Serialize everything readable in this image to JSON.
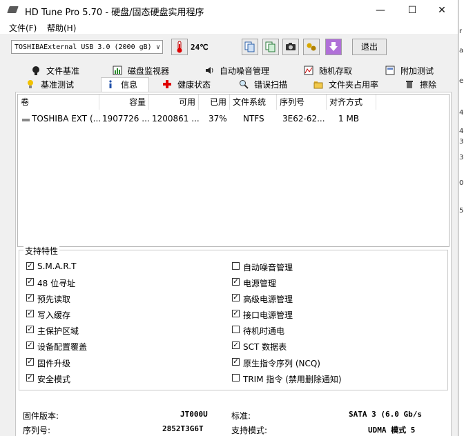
{
  "window": {
    "title": "HD Tune Pro 5.70 - 硬盘/固态硬盘实用程序"
  },
  "menu": [
    "文件(F)",
    "帮助(H)"
  ],
  "toolbar": {
    "drive": "TOSHIBAExternal USB 3.0 (2000 gB)",
    "temperature": "24℃",
    "exit_label": "退出"
  },
  "tabs_row1": [
    "文件基准",
    "磁盘监视器",
    "自动噪音管理",
    "随机存取",
    "附加测试"
  ],
  "tabs_row2": [
    "基准测试",
    "信息",
    "健康状态",
    "错误扫描",
    "文件夹占用率",
    "擦除"
  ],
  "active_tab": "信息",
  "volumes": {
    "columns": [
      "卷",
      "容量",
      "可用",
      "已用",
      "文件系统",
      "序列号",
      "对齐方式"
    ],
    "rows": [
      [
        "TOSHIBA EXT (...",
        "1907726 ...",
        "1200861 ...",
        "37%",
        "NTFS",
        "3E62-62...",
        "1 MB"
      ]
    ]
  },
  "features": {
    "legend": "支持特性",
    "left": [
      {
        "label": "S.M.A.R.T",
        "checked": true
      },
      {
        "label": "48 位寻址",
        "checked": true
      },
      {
        "label": "预先读取",
        "checked": true
      },
      {
        "label": "写入缓存",
        "checked": true
      },
      {
        "label": "主保护区域",
        "checked": true
      },
      {
        "label": "设备配置覆盖",
        "checked": true
      },
      {
        "label": "固件升级",
        "checked": true
      },
      {
        "label": "安全模式",
        "checked": true
      }
    ],
    "right": [
      {
        "label": "自动噪音管理",
        "checked": false
      },
      {
        "label": "电源管理",
        "checked": true
      },
      {
        "label": "高级电源管理",
        "checked": true
      },
      {
        "label": "接口电源管理",
        "checked": true
      },
      {
        "label": "待机时通电",
        "checked": false
      },
      {
        "label": "SCT 数据表",
        "checked": true
      },
      {
        "label": "原生指令序列 (NCQ)",
        "checked": true
      },
      {
        "label": "TRIM 指令 (禁用删除通知)",
        "checked": false
      }
    ]
  },
  "info": {
    "firmware_label": "固件版本:",
    "firmware_value": "JT000U",
    "serial_label": "序列号:",
    "serial_value": "2852T3G6T",
    "standard_label": "标准:",
    "standard_value": "SATA 3 (6.0 Gb/s",
    "mode_label": "支持模式:",
    "mode_value": "UDMA 模式 5"
  }
}
